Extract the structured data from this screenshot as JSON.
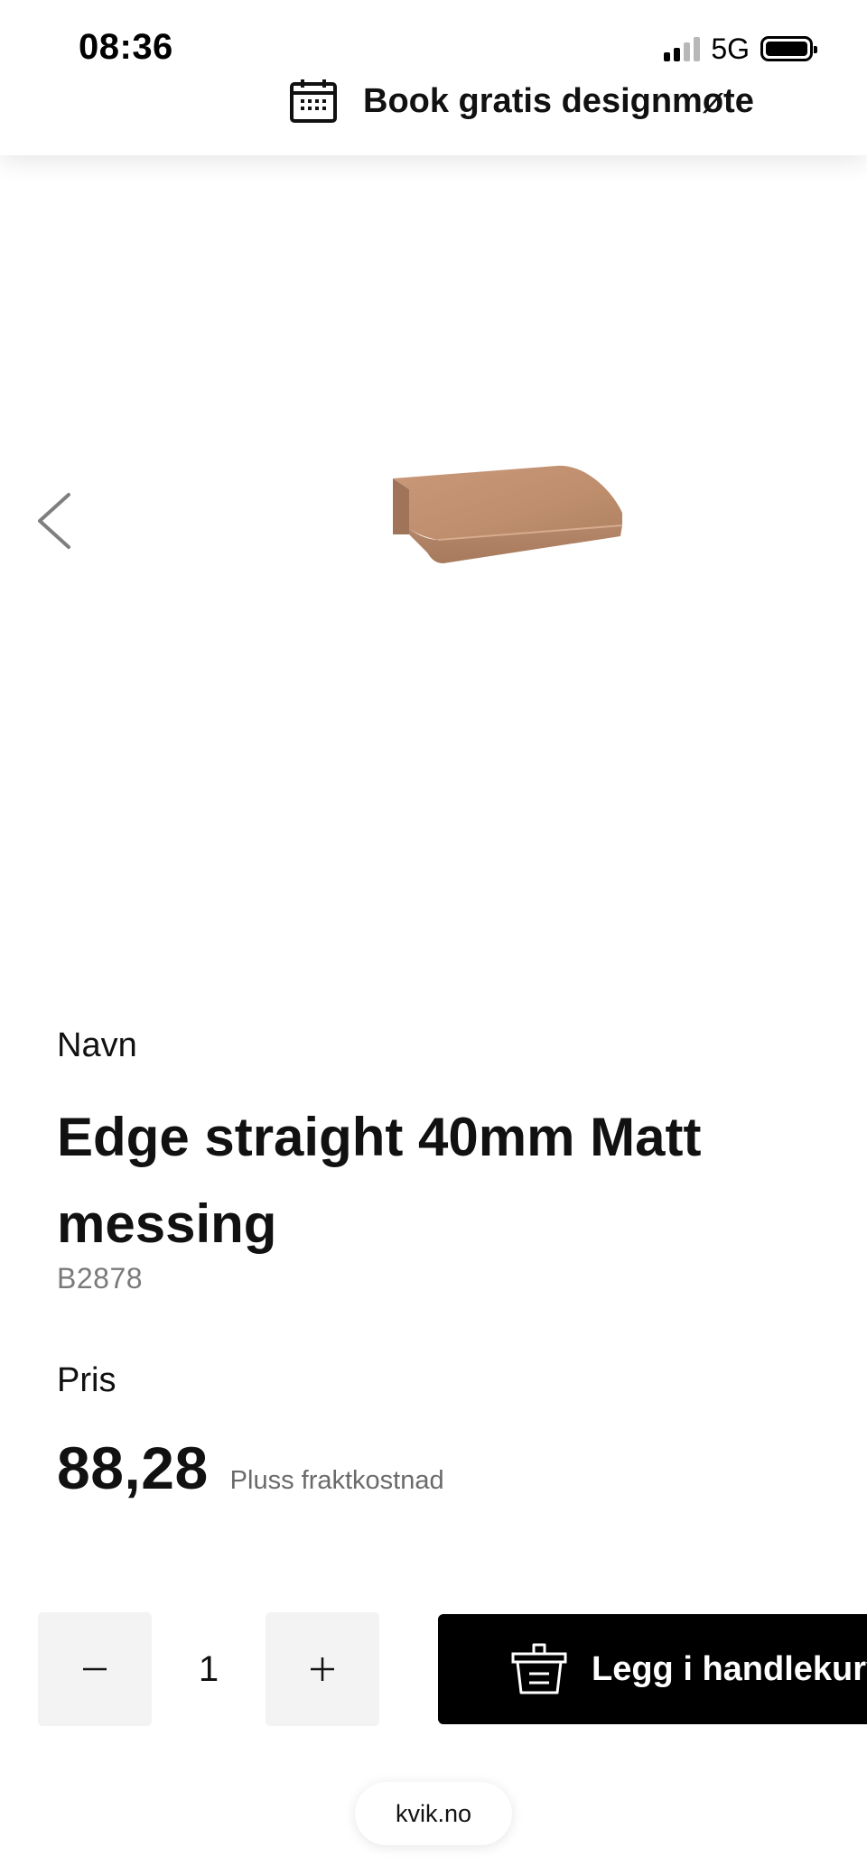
{
  "status_bar": {
    "time": "08:36",
    "network": "5G",
    "signal_icon": "signal-bars-icon",
    "battery_icon": "battery-icon"
  },
  "banner": {
    "book_label": "Book gratis designmøte",
    "icon": "calendar-icon"
  },
  "gallery": {
    "prev_icon": "chevron-left-icon",
    "image_alt": "Edge straight handle in matt brass",
    "product_color": "#c08f6f"
  },
  "product": {
    "name_label": "Navn",
    "title": "Edge straight 40mm Matt messing",
    "sku": "B2878",
    "price_label": "Pris",
    "price": "88,28",
    "shipping_note": "Pluss fraktkostnad"
  },
  "cart": {
    "quantity": "1",
    "minus_icon": "minus-icon",
    "plus_icon": "plus-icon",
    "basket_icon": "basket-icon",
    "add_label": "Legg i handlekurv"
  },
  "browser": {
    "url": "kvik.no"
  },
  "colors": {
    "button_bg": "#000000",
    "qty_bg": "#f3f3f3",
    "muted_text": "#7a7a7a"
  }
}
